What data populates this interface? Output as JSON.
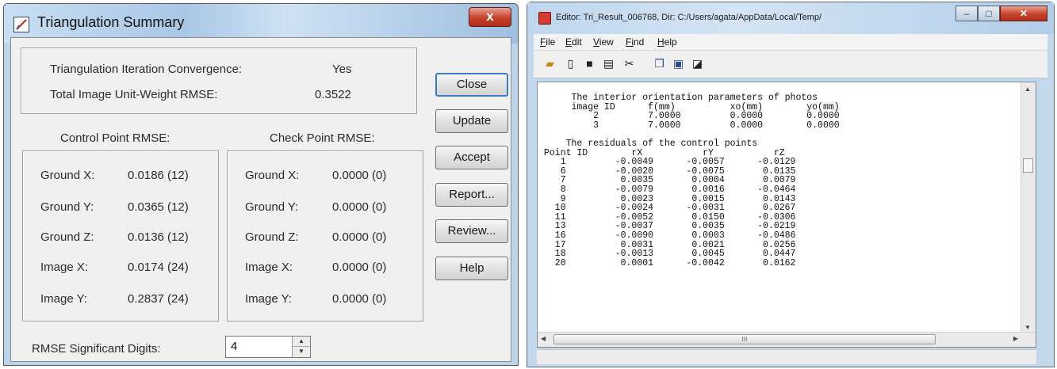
{
  "left_window": {
    "title": "Triangulation Summary",
    "close_glyph": "x",
    "convergence": {
      "label": "Triangulation Iteration Convergence:",
      "value": "Yes"
    },
    "rmse": {
      "label": "Total Image Unit-Weight RMSE:",
      "value": "0.3522"
    },
    "control_point_header": "Control Point RMSE:",
    "check_point_header": "Check Point RMSE:",
    "control_points": [
      {
        "label": "Ground X:",
        "value": "0.0186 (12)"
      },
      {
        "label": "Ground Y:",
        "value": "0.0365 (12)"
      },
      {
        "label": "Ground Z:",
        "value": "0.0136 (12)"
      },
      {
        "label": "Image X:",
        "value": "0.0174 (24)"
      },
      {
        "label": "Image Y:",
        "value": "0.2837 (24)"
      }
    ],
    "check_points": [
      {
        "label": "Ground X:",
        "value": "0.0000 (0)"
      },
      {
        "label": "Ground Y:",
        "value": "0.0000 (0)"
      },
      {
        "label": "Ground Z:",
        "value": "0.0000 (0)"
      },
      {
        "label": "Image X:",
        "value": "0.0000 (0)"
      },
      {
        "label": "Image Y:",
        "value": "0.0000 (0)"
      }
    ],
    "buttons": [
      "Close",
      "Update",
      "Accept",
      "Report...",
      "Review...",
      "Help"
    ],
    "digits_label": "RMSE Significant Digits:",
    "digits_value": "4"
  },
  "right_window": {
    "title": "Editor: Tri_Result_006768, Dir: C:/Users/agata/AppData/Local/Temp/",
    "menu": [
      {
        "u": "F",
        "rest": "ile"
      },
      {
        "u": "E",
        "rest": "dit"
      },
      {
        "u": "V",
        "rest": "iew"
      },
      {
        "u": "Fi",
        "rest": "nd"
      },
      {
        "u": "H",
        "rest": "elp"
      }
    ],
    "toolbar_icons": [
      "open-icon",
      "new-icon",
      "save-icon",
      "print-icon",
      "cut-icon",
      "copy-icon",
      "paste-icon",
      "find-icon"
    ],
    "content": "     The interior orientation parameters of photos\n     image ID      f(mm)          xo(mm)        yo(mm)\n         2         7.0000         0.0000        0.0000\n         3         7.0000         0.0000        0.0000\n\n    The residuals of the control points\nPoint ID        rX           rY           rZ\n   1         -0.0049      -0.0057      -0.0129\n   6         -0.0020      -0.0075       0.0135\n   7          0.0035       0.0004       0.0079\n   8         -0.0079       0.0016      -0.0464\n   9          0.0023       0.0015       0.0143\n  10         -0.0024      -0.0031       0.0267\n  11         -0.0052       0.0150      -0.0306\n  13         -0.0037       0.0035      -0.0219\n  16         -0.0090       0.0003      -0.0486\n  17          0.0031       0.0021       0.0256\n  18         -0.0013       0.0045       0.0447\n  20          0.0001      -0.0042       0.0162",
    "hscroll_grip": "III"
  }
}
